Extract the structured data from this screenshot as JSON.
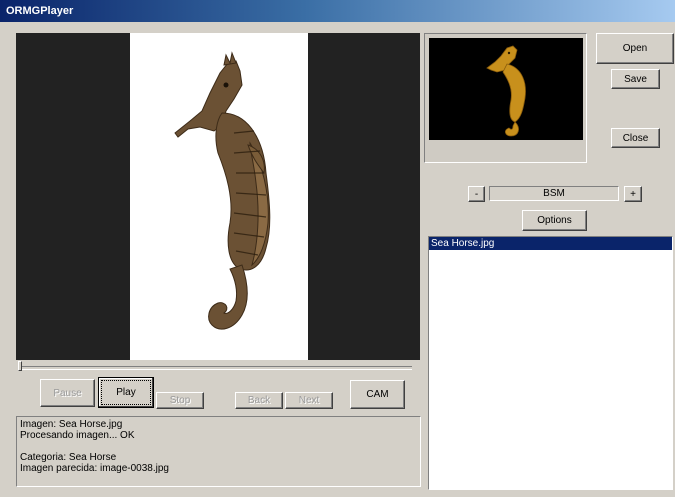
{
  "window": {
    "title": "ORMGPlayer"
  },
  "buttons": {
    "open": "Open",
    "save": "Save",
    "close": "Close",
    "options": "Options",
    "minus": "-",
    "plus": "+",
    "pause": "Pause",
    "play": "Play",
    "stop": "Stop",
    "back": "Back",
    "next": "Next",
    "cam": "CAM"
  },
  "algorithm": {
    "value": "BSM"
  },
  "file_list": {
    "items": [
      "Sea Horse.jpg"
    ],
    "selected_index": 0
  },
  "log": {
    "lines": [
      "Imagen: Sea Horse.jpg",
      "Procesando imagen... OK",
      "",
      "Categoria: Sea Horse",
      "Imagen parecida: image-0038.jpg"
    ]
  },
  "playback": {
    "position": 0
  },
  "colors": {
    "seahorse_main": "#6b5134",
    "seahorse_thumb": "#c8901c"
  }
}
